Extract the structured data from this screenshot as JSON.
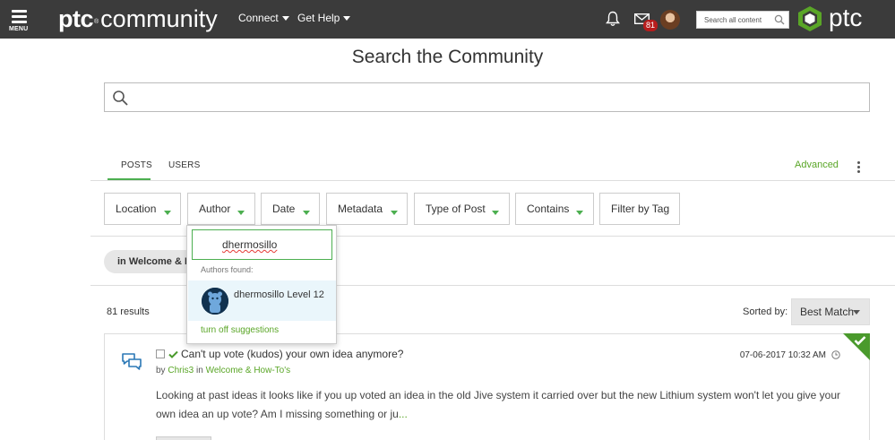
{
  "header": {
    "menu_label": "MENU",
    "brand_ptc": "ptc",
    "brand_reg": "®",
    "brand_community": "community",
    "nav": [
      {
        "label": "Connect"
      },
      {
        "label": "Get Help"
      }
    ],
    "inbox_badge": "81",
    "search_placeholder": "Search all content",
    "logo_word": "ptc"
  },
  "main": {
    "title": "Search the Community",
    "search_value": "",
    "tabs": [
      {
        "label": "POSTS",
        "active": true
      },
      {
        "label": "USERS",
        "active": false
      }
    ],
    "advanced_label": "Advanced",
    "filters": [
      {
        "label": "Location"
      },
      {
        "label": "Author"
      },
      {
        "label": "Date"
      },
      {
        "label": "Metadata"
      },
      {
        "label": "Type of Post"
      },
      {
        "label": "Contains"
      },
      {
        "label": "Filter by Tag"
      }
    ],
    "active_filter_chip": "in Welcome & H",
    "results_count": "81 results",
    "sorted_by_label": "Sorted by:",
    "sort_value": "Best Match"
  },
  "author_dropdown": {
    "input_value": "dhermosillo",
    "found_label": "Authors found:",
    "suggestion": {
      "name": "dhermosillo",
      "level": "Level 12"
    },
    "turn_off_label": "turn off suggestions"
  },
  "result": {
    "title": "Can't up vote (kudos) your own idea anymore?",
    "by_label": "by",
    "author": "Chris3",
    "in_label": "in",
    "location": "Welcome & How-To's",
    "date": "07-06-2017 10:32 AM",
    "snippet": "Looking at past ideas it looks like if you up voted an idea in the old Jive system it carried over but the new Lithium system won't let you give your own idea an up vote? Am I missing something or ju",
    "ellipsis": "...",
    "solved": true
  },
  "colors": {
    "topbar": "#3b3b3b",
    "accent_green": "#5aa627",
    "badge_red": "#b71c1c"
  }
}
